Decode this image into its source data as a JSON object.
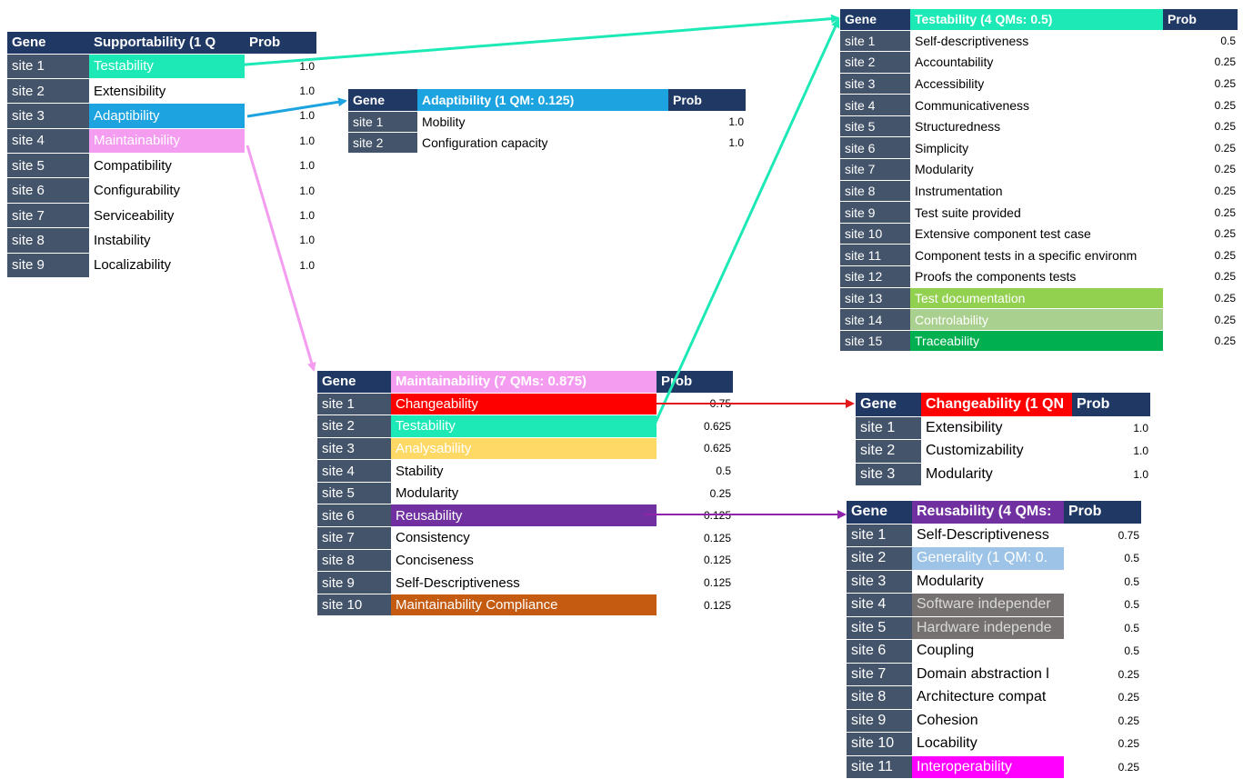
{
  "tables": {
    "supportability": {
      "headers": {
        "gene": "Gene",
        "title": "Supportability  (1 Q",
        "prob": "Prob"
      },
      "rows": [
        {
          "site": "site 1",
          "name": "Testability",
          "prob": "1.0",
          "bg": "#1de9b6",
          "fg": "#ffffff"
        },
        {
          "site": "site 2",
          "name": "Extensibility",
          "prob": "1.0"
        },
        {
          "site": "site 3",
          "name": "Adaptibility",
          "prob": "1.0",
          "bg": "#1ca3e0",
          "fg": "#ffffff"
        },
        {
          "site": "site 4",
          "name": "Maintainability",
          "prob": "1.0",
          "bg": "#f49df0",
          "fg": "#ffffff"
        },
        {
          "site": "site 5",
          "name": "Compatibility",
          "prob": "1.0"
        },
        {
          "site": "site 6",
          "name": "Configurability",
          "prob": "1.0"
        },
        {
          "site": "site 7",
          "name": "Serviceability",
          "prob": "1.0"
        },
        {
          "site": "site 8",
          "name": "Instability",
          "prob": "1.0"
        },
        {
          "site": "site 9",
          "name": "Localizability",
          "prob": "1.0"
        }
      ]
    },
    "adaptibility": {
      "headers": {
        "gene": "Gene",
        "title": "Adaptibility  (1 QM: 0.125)",
        "prob": "Prob"
      },
      "title_bg": "#1ca3e0",
      "rows": [
        {
          "site": "site 1",
          "name": "Mobility",
          "prob": "1.0"
        },
        {
          "site": "site 2",
          "name": "Configuration capacity",
          "prob": "1.0"
        }
      ]
    },
    "testability": {
      "headers": {
        "gene": "Gene",
        "title": "Testability  (4 QMs: 0.5)",
        "prob": "Prob"
      },
      "title_bg": "#1de9b6",
      "rows": [
        {
          "site": "site 1",
          "name": "Self-descriptiveness",
          "prob": "0.5"
        },
        {
          "site": "site 2",
          "name": "Accountability",
          "prob": "0.25"
        },
        {
          "site": "site 3",
          "name": "Accessibility",
          "prob": "0.25"
        },
        {
          "site": "site 4",
          "name": "Communicativeness",
          "prob": "0.25"
        },
        {
          "site": "site 5",
          "name": "Structuredness",
          "prob": "0.25"
        },
        {
          "site": "site 6",
          "name": "Simplicity",
          "prob": "0.25"
        },
        {
          "site": "site 7",
          "name": "Modularity",
          "prob": "0.25"
        },
        {
          "site": "site 8",
          "name": "Instrumentation",
          "prob": "0.25"
        },
        {
          "site": "site 9",
          "name": "Test suite provided",
          "prob": "0.25"
        },
        {
          "site": "site 10",
          "name": "Extensive component test case",
          "prob": "0.25"
        },
        {
          "site": "site 11",
          "name": "Component tests in a specific environm",
          "prob": "0.25"
        },
        {
          "site": "site 12",
          "name": "Proofs the components tests",
          "prob": "0.25"
        },
        {
          "site": "site 13",
          "name": "Test documentation",
          "prob": "0.25",
          "bg": "#92d050",
          "fg": "#ffffff"
        },
        {
          "site": "site 14",
          "name": "Controlability",
          "prob": "0.25",
          "bg": "#a9d08e",
          "fg": "#ffffff"
        },
        {
          "site": "site 15",
          "name": "Traceability",
          "prob": "0.25",
          "bg": "#00b050",
          "fg": "#ffffff"
        }
      ]
    },
    "maintainability": {
      "headers": {
        "gene": "Gene",
        "title": "Maintainability  (7 QMs: 0.875)",
        "prob": "Prob"
      },
      "title_bg": "#f49df0",
      "rows": [
        {
          "site": "site 1",
          "name": "Changeability",
          "prob": "0.75",
          "bg": "#ff0000",
          "fg": "#ffffff"
        },
        {
          "site": "site 2",
          "name": "Testability",
          "prob": "0.625",
          "bg": "#1de9b6",
          "fg": "#ffffff"
        },
        {
          "site": "site 3",
          "name": "Analysability",
          "prob": "0.625",
          "bg": "#ffd966",
          "fg": "#ffffff"
        },
        {
          "site": "site 4",
          "name": "Stability",
          "prob": "0.5"
        },
        {
          "site": "site 5",
          "name": "Modularity",
          "prob": "0.25"
        },
        {
          "site": "site 6",
          "name": "Reusability",
          "prob": "0.125",
          "bg": "#7030a0",
          "fg": "#ffffff"
        },
        {
          "site": "site 7",
          "name": "Consistency",
          "prob": "0.125"
        },
        {
          "site": "site 8",
          "name": "Conciseness",
          "prob": "0.125"
        },
        {
          "site": "site 9",
          "name": "Self-Descriptiveness",
          "prob": "0.125"
        },
        {
          "site": "site 10",
          "name": "Maintainability Compliance",
          "prob": "0.125",
          "bg": "#c55a11",
          "fg": "#ffffff"
        }
      ]
    },
    "changeability": {
      "headers": {
        "gene": "Gene",
        "title": "Changeability  (1 QN",
        "prob": "Prob"
      },
      "title_bg": "#ff0000",
      "rows": [
        {
          "site": "site 1",
          "name": "Extensibility",
          "prob": "1.0"
        },
        {
          "site": "site 2",
          "name": "Customizability",
          "prob": "1.0"
        },
        {
          "site": "site 3",
          "name": "Modularity",
          "prob": "1.0"
        }
      ]
    },
    "reusability": {
      "headers": {
        "gene": "Gene",
        "title": "Reusability  (4 QMs:",
        "prob": "Prob"
      },
      "title_bg": "#7030a0",
      "rows": [
        {
          "site": "site 1",
          "name": "Self-Descriptiveness",
          "prob": "0.75"
        },
        {
          "site": "site 2",
          "name": "Generality  (1 QM: 0.",
          "prob": "0.5",
          "bg": "#9dc3e6",
          "fg": "#ffffff"
        },
        {
          "site": "site 3",
          "name": "Modularity",
          "prob": "0.5"
        },
        {
          "site": "site 4",
          "name": "Software independer",
          "prob": "0.5",
          "bg": "#767171",
          "fg": "#d9d9d9"
        },
        {
          "site": "site 5",
          "name": "Hardware independe",
          "prob": "0.5",
          "bg": "#767171",
          "fg": "#d9d9d9"
        },
        {
          "site": "site 6",
          "name": "Coupling",
          "prob": "0.5"
        },
        {
          "site": "site 7",
          "name": "Domain abstraction l",
          "prob": "0.25"
        },
        {
          "site": "site 8",
          "name": "Architecture compat",
          "prob": "0.25"
        },
        {
          "site": "site 9",
          "name": "Cohesion",
          "prob": "0.25"
        },
        {
          "site": "site 10",
          "name": "Locability",
          "prob": "0.25"
        },
        {
          "site": "site 11",
          "name": "Interoperability",
          "prob": "0.25",
          "bg": "#ff00ff",
          "fg": "#ffffff"
        }
      ]
    }
  },
  "colors": {
    "header_bg": "#1f3864",
    "site_bg": "#44546a",
    "arrow_testability": "#1de9b6",
    "arrow_adaptibility": "#1ca3e0",
    "arrow_maintainability": "#f49df0",
    "arrow_changeability": "#e31a1c",
    "arrow_reusability": "#8e24aa"
  }
}
